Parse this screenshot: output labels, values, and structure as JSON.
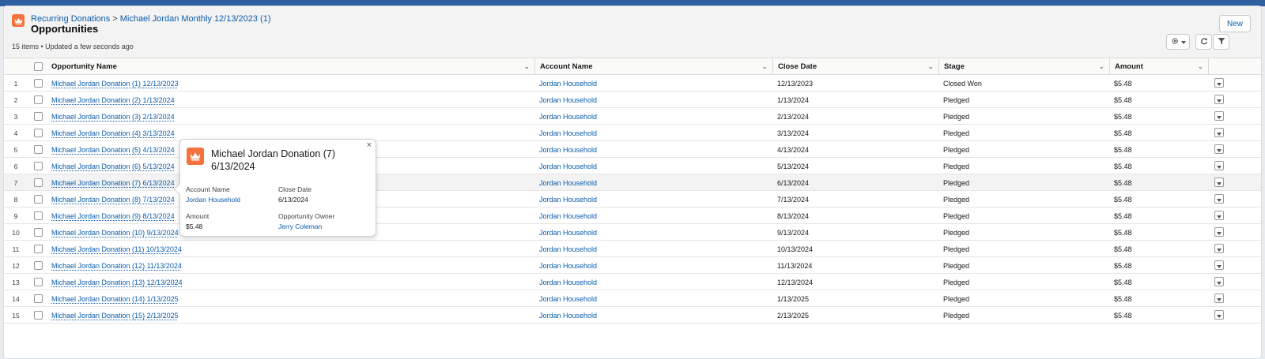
{
  "header": {
    "breadcrumb": [
      {
        "label": "Recurring Donations"
      },
      {
        "label": "Michael Jordan Monthly 12/13/2023 (1)"
      }
    ],
    "breadcrumb_separator": ">",
    "title": "Opportunities",
    "meta": "15 items • Updated a few seconds ago",
    "new_button": "New",
    "object_icon": "crown-icon",
    "brand_color": "#f4723d"
  },
  "columns": [
    "Opportunity Name",
    "Account Name",
    "Close Date",
    "Stage",
    "Amount"
  ],
  "rows": [
    {
      "num": "1",
      "name": "Michael Jordan Donation (1) 12/13/2023",
      "account": "Jordan Household",
      "close": "12/13/2023",
      "stage": "Closed Won",
      "amount": "$5.48"
    },
    {
      "num": "2",
      "name": "Michael Jordan Donation (2) 1/13/2024",
      "account": "Jordan Household",
      "close": "1/13/2024",
      "stage": "Pledged",
      "amount": "$5.48"
    },
    {
      "num": "3",
      "name": "Michael Jordan Donation (3) 2/13/2024",
      "account": "Jordan Household",
      "close": "2/13/2024",
      "stage": "Pledged",
      "amount": "$5.48"
    },
    {
      "num": "4",
      "name": "Michael Jordan Donation (4) 3/13/2024",
      "account": "Jordan Household",
      "close": "3/13/2024",
      "stage": "Pledged",
      "amount": "$5.48"
    },
    {
      "num": "5",
      "name": "Michael Jordan Donation (5) 4/13/2024",
      "account": "Jordan Household",
      "close": "4/13/2024",
      "stage": "Pledged",
      "amount": "$5.48"
    },
    {
      "num": "6",
      "name": "Michael Jordan Donation (6) 5/13/2024",
      "account": "Jordan Household",
      "close": "5/13/2024",
      "stage": "Pledged",
      "amount": "$5.48"
    },
    {
      "num": "7",
      "name": "Michael Jordan Donation (7) 6/13/2024",
      "account": "Jordan Household",
      "close": "6/13/2024",
      "stage": "Pledged",
      "amount": "$5.48"
    },
    {
      "num": "8",
      "name": "Michael Jordan Donation (8) 7/13/2024",
      "account": "Jordan Household",
      "close": "7/13/2024",
      "stage": "Pledged",
      "amount": "$5.48"
    },
    {
      "num": "9",
      "name": "Michael Jordan Donation (9) 8/13/2024",
      "account": "Jordan Household",
      "close": "8/13/2024",
      "stage": "Pledged",
      "amount": "$5.48"
    },
    {
      "num": "10",
      "name": "Michael Jordan Donation (10) 9/13/2024",
      "account": "Jordan Household",
      "close": "9/13/2024",
      "stage": "Pledged",
      "amount": "$5.48"
    },
    {
      "num": "11",
      "name": "Michael Jordan Donation (11) 10/13/2024",
      "account": "Jordan Household",
      "close": "10/13/2024",
      "stage": "Pledged",
      "amount": "$5.48"
    },
    {
      "num": "12",
      "name": "Michael Jordan Donation (12) 11/13/2024",
      "account": "Jordan Household",
      "close": "11/13/2024",
      "stage": "Pledged",
      "amount": "$5.48"
    },
    {
      "num": "13",
      "name": "Michael Jordan Donation (13) 12/13/2024",
      "account": "Jordan Household",
      "close": "12/13/2024",
      "stage": "Pledged",
      "amount": "$5.48"
    },
    {
      "num": "14",
      "name": "Michael Jordan Donation (14) 1/13/2025",
      "account": "Jordan Household",
      "close": "1/13/2025",
      "stage": "Pledged",
      "amount": "$5.48"
    },
    {
      "num": "15",
      "name": "Michael Jordan Donation (15) 2/13/2025",
      "account": "Jordan Household",
      "close": "2/13/2025",
      "stage": "Pledged",
      "amount": "$5.48"
    }
  ],
  "popover": {
    "title": "Michael Jordan Donation (7) 6/13/2024",
    "account_label": "Account Name",
    "account_value": "Jordan Household",
    "close_label": "Close Date",
    "close_value": "6/13/2024",
    "amount_label": "Amount",
    "amount_value": "$5.48",
    "owner_label": "Opportunity Owner",
    "owner_value": "Jerry Coleman",
    "close_glyph": "×"
  }
}
